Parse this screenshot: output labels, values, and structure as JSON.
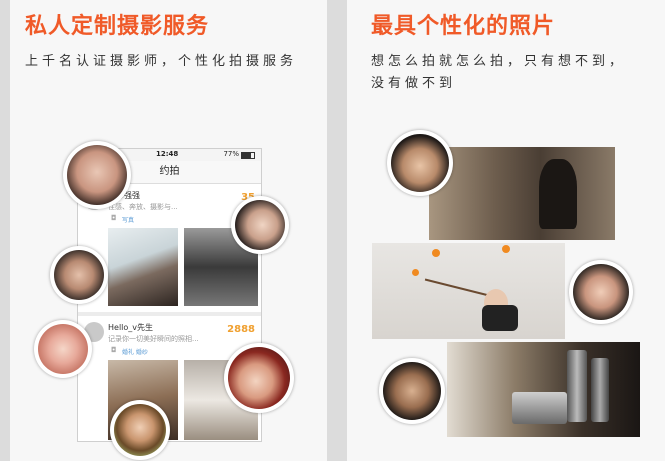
{
  "left": {
    "headline": "私人定制摄影服务",
    "subtitle": "上千名认证摄影师，个性化拍摄服务",
    "phone": {
      "time": "12:48",
      "battery": "77%",
      "nav_title": "约拍",
      "cards": [
        {
          "name": "影师强强",
          "desc": "性感、奔放、摄影与...",
          "count": "35",
          "tags": "写真"
        },
        {
          "name": "Hello_v先生",
          "desc": "记录你一切美好瞬间的照相...",
          "count": "2888",
          "tags": "婚礼 婚纱"
        }
      ]
    }
  },
  "right": {
    "headline": "最具个性化的照片",
    "subtitle_line1": "想怎么拍就怎么拍，只有想不到，",
    "subtitle_line2": "没有做不到"
  }
}
